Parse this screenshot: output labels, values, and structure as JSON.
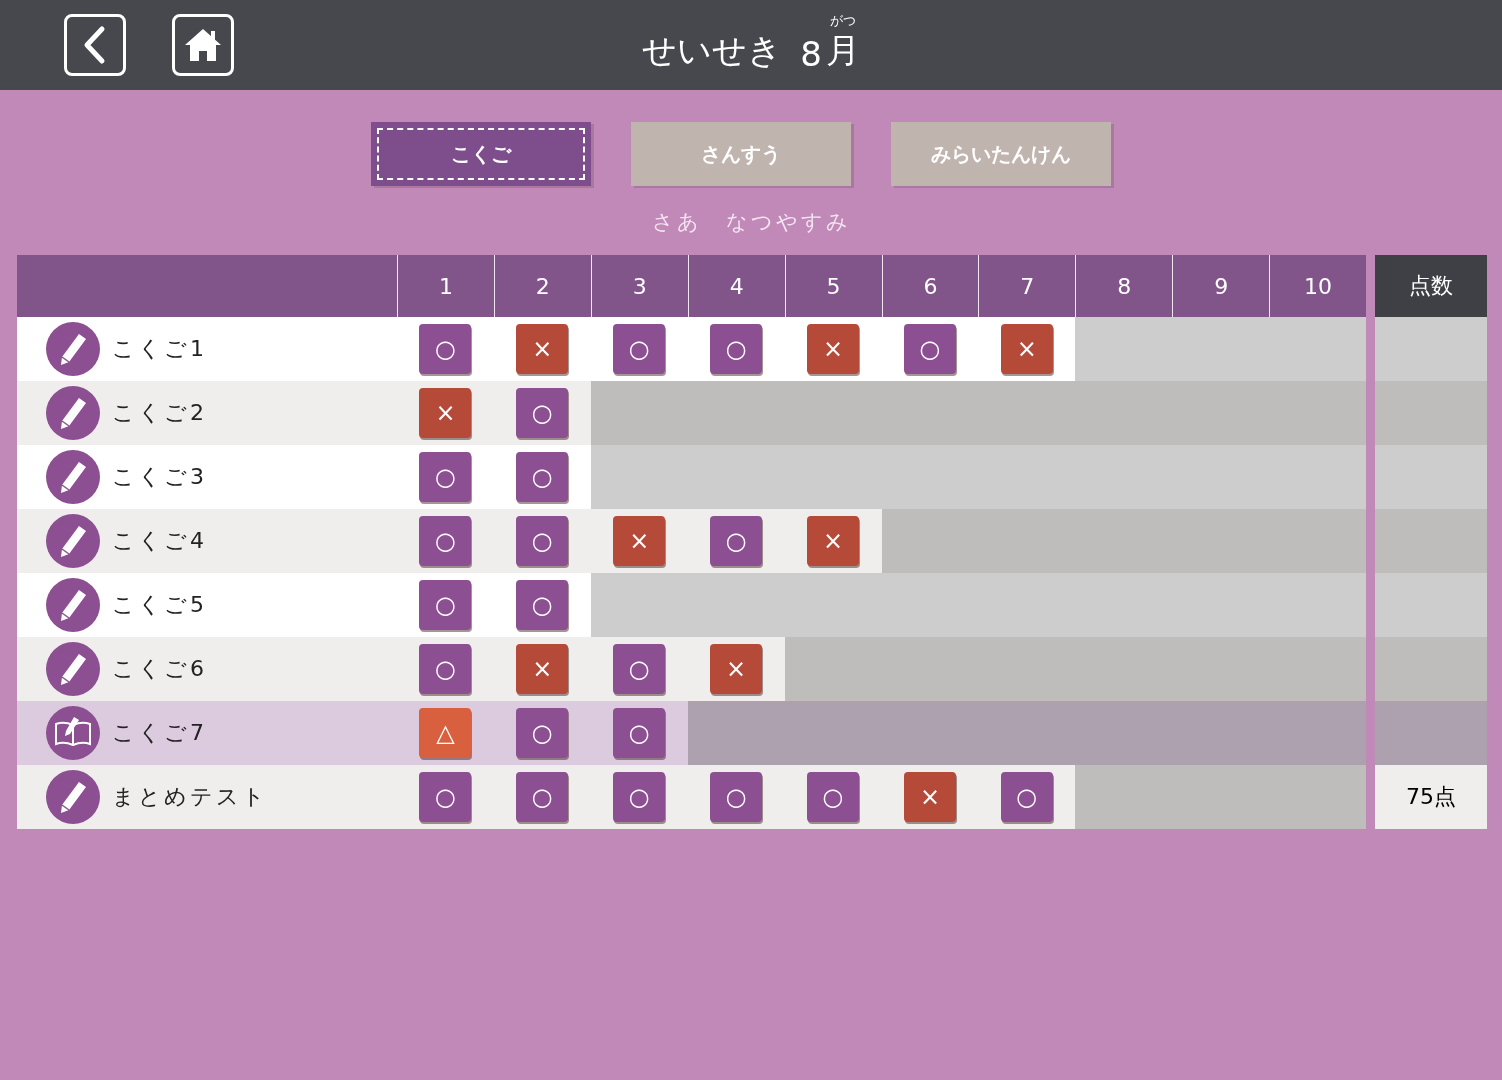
{
  "header": {
    "title": "せいせき",
    "month_number": "8",
    "month_kanji": "月",
    "month_reading": "がつ"
  },
  "tabs": [
    {
      "label": "こくご",
      "selected": true
    },
    {
      "label": "さんすう",
      "selected": false
    },
    {
      "label": "みらいたんけん",
      "selected": false
    }
  ],
  "subtitle": "さあ　なつやすみ",
  "table": {
    "columns": [
      "1",
      "2",
      "3",
      "4",
      "5",
      "6",
      "7",
      "8",
      "9",
      "10"
    ],
    "score_heading": "点数",
    "rows": [
      {
        "name": "こくご1",
        "kind": "pencil",
        "selected": false,
        "marks": [
          {
            "kind": "correct",
            "symbol": "○"
          },
          {
            "kind": "wrong",
            "symbol": "×"
          },
          {
            "kind": "correct",
            "symbol": "○"
          },
          {
            "kind": "correct",
            "symbol": "○"
          },
          {
            "kind": "wrong",
            "symbol": "×"
          },
          {
            "kind": "correct",
            "symbol": "○"
          },
          {
            "kind": "wrong",
            "symbol": "×"
          }
        ]
      },
      {
        "name": "こくご2",
        "kind": "pencil",
        "selected": false,
        "marks": [
          {
            "kind": "wrong",
            "symbol": "×"
          },
          {
            "kind": "correct",
            "symbol": "○"
          }
        ]
      },
      {
        "name": "こくご3",
        "kind": "pencil",
        "selected": false,
        "marks": [
          {
            "kind": "correct",
            "symbol": "○"
          },
          {
            "kind": "correct",
            "symbol": "○"
          }
        ]
      },
      {
        "name": "こくご4",
        "kind": "pencil",
        "selected": false,
        "marks": [
          {
            "kind": "correct",
            "symbol": "○"
          },
          {
            "kind": "correct",
            "symbol": "○"
          },
          {
            "kind": "wrong",
            "symbol": "×"
          },
          {
            "kind": "correct",
            "symbol": "○"
          },
          {
            "kind": "wrong",
            "symbol": "×"
          }
        ]
      },
      {
        "name": "こくご5",
        "kind": "pencil",
        "selected": false,
        "marks": [
          {
            "kind": "correct",
            "symbol": "○"
          },
          {
            "kind": "correct",
            "symbol": "○"
          }
        ]
      },
      {
        "name": "こくご6",
        "kind": "pencil",
        "selected": false,
        "marks": [
          {
            "kind": "correct",
            "symbol": "○"
          },
          {
            "kind": "wrong",
            "symbol": "×"
          },
          {
            "kind": "correct",
            "symbol": "○"
          },
          {
            "kind": "wrong",
            "symbol": "×"
          }
        ]
      },
      {
        "name": "こくご7",
        "kind": "book",
        "selected": true,
        "marks": [
          {
            "kind": "partial",
            "symbol": "△"
          },
          {
            "kind": "correct",
            "symbol": "○"
          },
          {
            "kind": "correct",
            "symbol": "○"
          }
        ]
      },
      {
        "name": "まとめテスト",
        "kind": "pencil",
        "selected": false,
        "score": "75点",
        "marks": [
          {
            "kind": "correct",
            "symbol": "○"
          },
          {
            "kind": "correct",
            "symbol": "○"
          },
          {
            "kind": "correct",
            "symbol": "○"
          },
          {
            "kind": "correct",
            "symbol": "○"
          },
          {
            "kind": "correct",
            "symbol": "○"
          },
          {
            "kind": "wrong",
            "symbol": "×"
          },
          {
            "kind": "correct",
            "symbol": "○"
          }
        ]
      }
    ]
  }
}
